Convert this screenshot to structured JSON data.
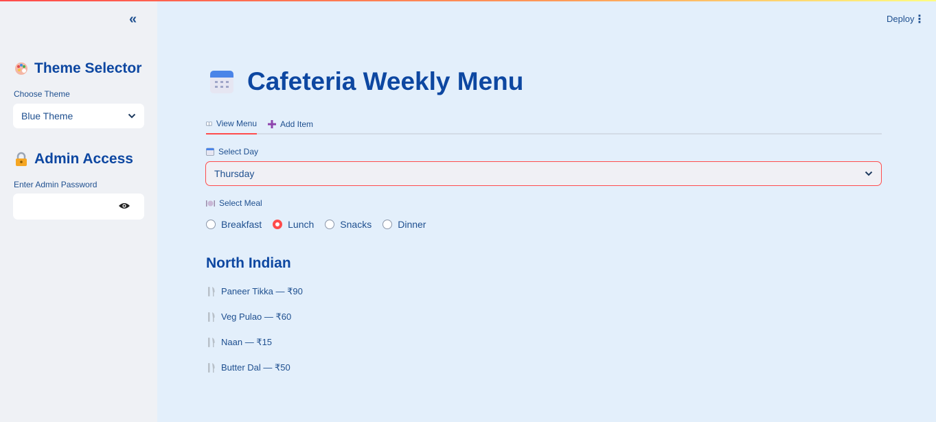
{
  "header": {
    "collapse_glyph": "«",
    "deploy_label": "Deploy",
    "menu_glyph": "⋮"
  },
  "sidebar": {
    "theme_heading": "Theme Selector",
    "theme_label": "Choose Theme",
    "theme_value": "Blue Theme",
    "admin_heading": "Admin Access",
    "password_label": "Enter Admin Password",
    "password_value": ""
  },
  "main": {
    "title": "Cafeteria Weekly Menu",
    "tabs": [
      {
        "label": "View Menu",
        "icon": "open-book-icon",
        "active": true
      },
      {
        "label": "Add Item",
        "icon": "plus-icon",
        "active": false
      }
    ],
    "day_label": "Select Day",
    "day_value": "Thursday",
    "meal_label": "Select Meal",
    "meals": [
      "Breakfast",
      "Lunch",
      "Snacks",
      "Dinner"
    ],
    "selected_meal": "Lunch",
    "section_title": "North Indian",
    "items": [
      "Paneer Tikka — ₹90",
      "Veg Pulao — ₹60",
      "Naan — ₹15",
      "Butter Dal — ₹50"
    ]
  },
  "colors": {
    "accent": "#ff4b4b",
    "heading": "#0d47a1",
    "text": "#1e4f8f",
    "main_bg": "#e3effb",
    "sidebar_bg": "#eff1f5"
  }
}
